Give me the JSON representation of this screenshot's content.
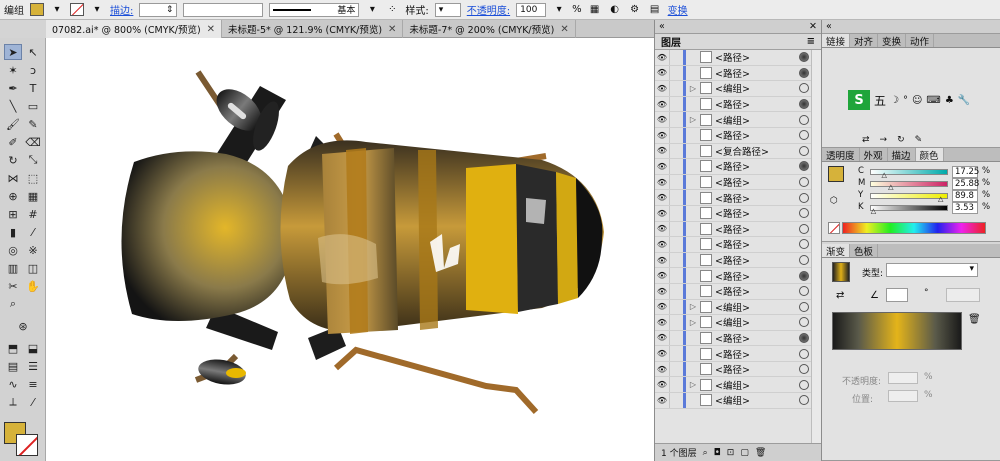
{
  "control_bar": {
    "group_label": "编组",
    "stroke_link": "描边:",
    "stroke_profile": "基本",
    "style_label": "样式:",
    "opacity_link": "不透明度:",
    "opacity_value": "100",
    "opacity_unit": "%",
    "transform_link": "变换",
    "fill_color": "#d6b23a"
  },
  "doc_tabs": [
    {
      "label": "07082.ai* @ 800% (CMYK/预览)"
    },
    {
      "label": "未标题-5* @ 121.9% (CMYK/预览)"
    },
    {
      "label": "未标题-7* @ 200% (CMYK/预览)"
    }
  ],
  "layers_panel": {
    "title": "图层",
    "footer": "1 个图层",
    "rows": [
      {
        "name": "<路径>",
        "tri": "",
        "target": "filled"
      },
      {
        "name": "<路径>",
        "tri": "",
        "target": "filled"
      },
      {
        "name": "<编组>",
        "tri": "▷",
        "target": "empty"
      },
      {
        "name": "<路径>",
        "tri": "",
        "target": "filled"
      },
      {
        "name": "<编组>",
        "tri": "▷",
        "target": "empty"
      },
      {
        "name": "<路径>",
        "tri": "",
        "target": "empty"
      },
      {
        "name": "<复合路径>",
        "tri": "",
        "target": "empty"
      },
      {
        "name": "<路径>",
        "tri": "",
        "target": "filled"
      },
      {
        "name": "<路径>",
        "tri": "",
        "target": "empty"
      },
      {
        "name": "<路径>",
        "tri": "",
        "target": "empty"
      },
      {
        "name": "<路径>",
        "tri": "",
        "target": "empty"
      },
      {
        "name": "<路径>",
        "tri": "",
        "target": "empty"
      },
      {
        "name": "<路径>",
        "tri": "",
        "target": "empty"
      },
      {
        "name": "<路径>",
        "tri": "",
        "target": "empty"
      },
      {
        "name": "<路径>",
        "tri": "",
        "target": "filled"
      },
      {
        "name": "<路径>",
        "tri": "",
        "target": "empty"
      },
      {
        "name": "<编组>",
        "tri": "▷",
        "target": "empty"
      },
      {
        "name": "<编组>",
        "tri": "▷",
        "target": "empty"
      },
      {
        "name": "<路径>",
        "tri": "",
        "target": "filled"
      },
      {
        "name": "<路径>",
        "tri": "",
        "target": "empty"
      },
      {
        "name": "<路径>",
        "tri": "",
        "target": "empty"
      },
      {
        "name": "<编组>",
        "tri": "▷",
        "target": "empty"
      },
      {
        "name": "<编组>",
        "tri": "",
        "target": "empty"
      }
    ]
  },
  "top_panel_tabs": [
    "链接",
    "对齐",
    "变换",
    "动作"
  ],
  "ime_bar": {
    "label": "五"
  },
  "color_panel": {
    "tabs": [
      "透明度",
      "外观",
      "描边",
      "颜色"
    ],
    "channels": [
      {
        "label": "C",
        "value": "17.25",
        "pct": 17.25
      },
      {
        "label": "M",
        "value": "25.88",
        "pct": 25.88
      },
      {
        "label": "Y",
        "value": "89.8",
        "pct": 89.8
      },
      {
        "label": "K",
        "value": "3.53",
        "pct": 3.53
      }
    ],
    "unit": "%"
  },
  "gradient_panel": {
    "tabs": [
      "渐变",
      "色板"
    ],
    "type_label": "类型:",
    "opacity_label": "不透明度:",
    "location_label": "位置:",
    "unit": "%",
    "angle_unit": "°"
  }
}
